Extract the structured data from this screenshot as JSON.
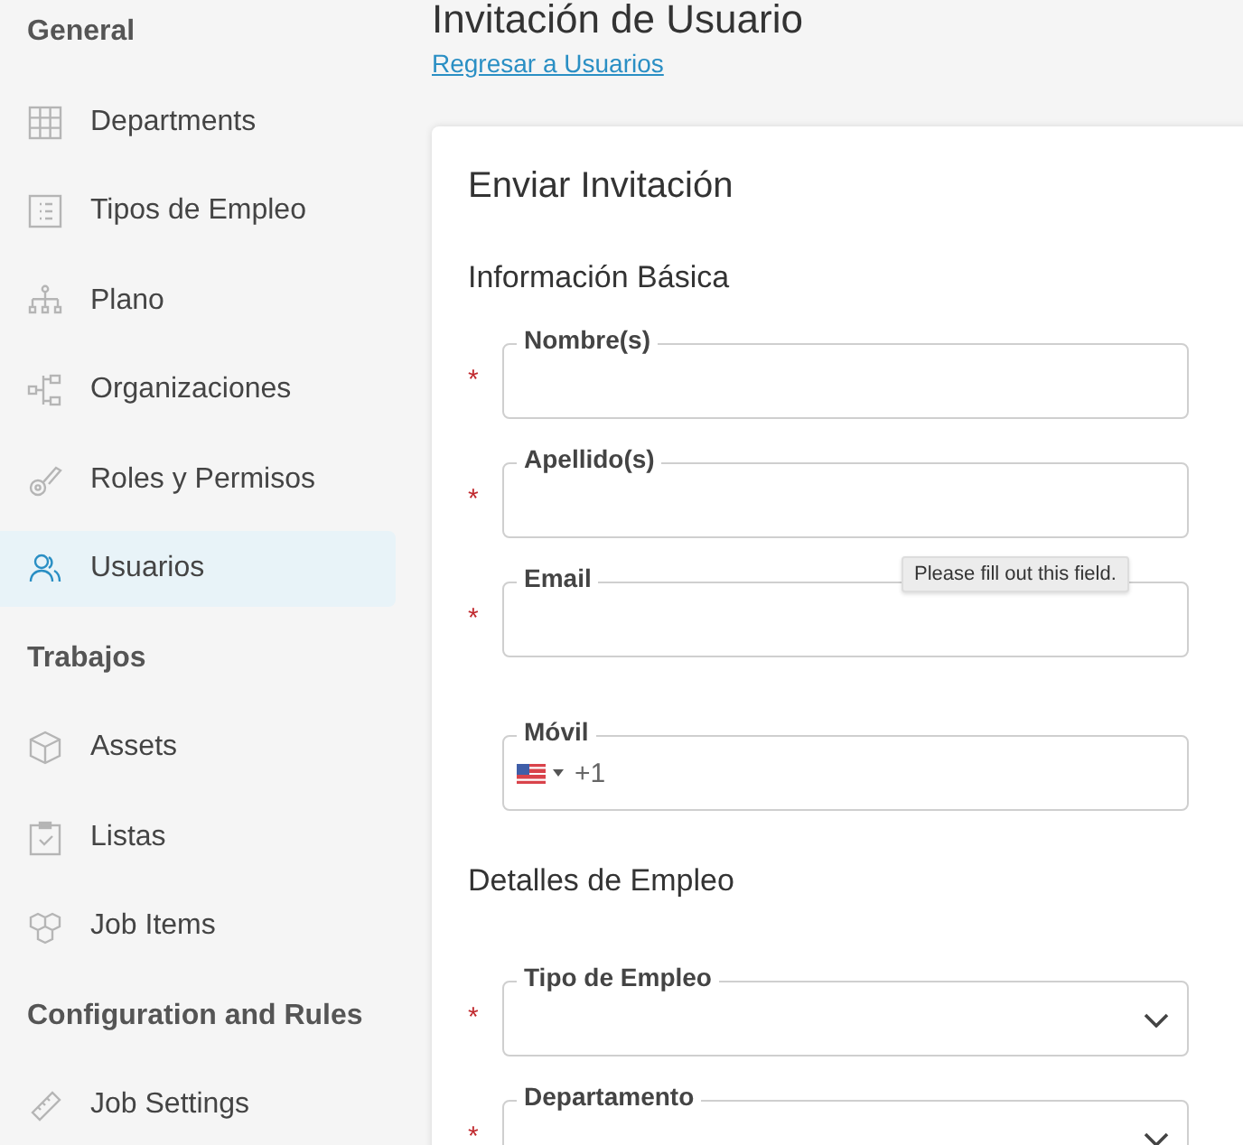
{
  "sidebar": {
    "groups": [
      {
        "title": "General",
        "items": [
          {
            "label": "Departments",
            "selected": false
          },
          {
            "label": "Tipos de Empleo",
            "selected": false
          },
          {
            "label": "Plano",
            "selected": false
          },
          {
            "label": "Organizaciones",
            "selected": false
          },
          {
            "label": "Roles y Permisos",
            "selected": false
          },
          {
            "label": "Usuarios",
            "selected": true
          }
        ]
      },
      {
        "title": "Trabajos",
        "items": [
          {
            "label": "Assets",
            "selected": false
          },
          {
            "label": "Listas",
            "selected": false
          },
          {
            "label": "Job Items",
            "selected": false
          }
        ]
      },
      {
        "title": "Configuration and Rules",
        "items": [
          {
            "label": "Job Settings",
            "selected": false
          }
        ]
      }
    ]
  },
  "page": {
    "title": "Invitación de Usuario",
    "back_link": "Regresar a Usuarios"
  },
  "form": {
    "title": "Enviar Invitación",
    "required_mark": "*",
    "sections": [
      {
        "title": "Información Básica",
        "fields": [
          {
            "kind": "text",
            "label": "Nombre(s)",
            "required": true
          },
          {
            "kind": "text",
            "label": "Apellido(s)",
            "required": true
          },
          {
            "kind": "text",
            "label": "Email",
            "required": true,
            "tooltip": "Please fill out this field."
          },
          {
            "kind": "phone",
            "label": "Móvil",
            "required": false,
            "dial_code": "+1"
          }
        ]
      },
      {
        "title": "Detalles de Empleo",
        "fields": [
          {
            "kind": "select",
            "label": "Tipo de Empleo",
            "required": true
          },
          {
            "kind": "select",
            "label": "Departamento",
            "required": true
          }
        ]
      }
    ]
  }
}
